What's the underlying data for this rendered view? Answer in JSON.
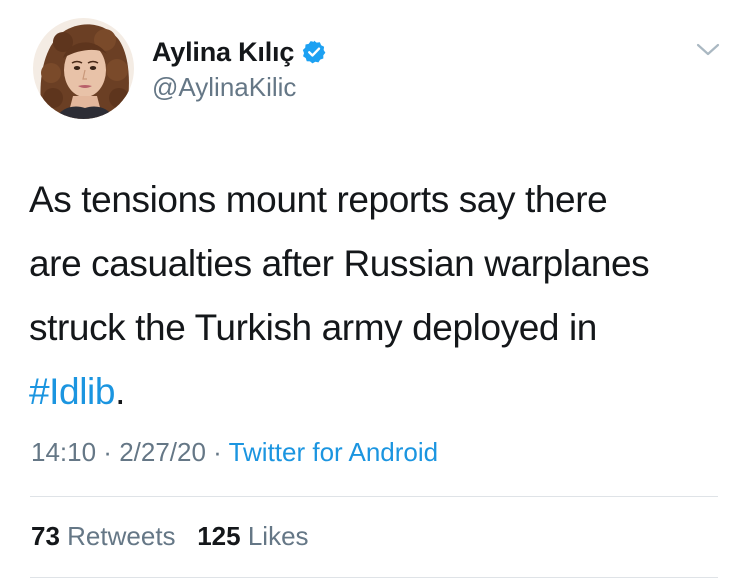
{
  "author": {
    "display_name": "Aylina Kılıç",
    "handle": "@AylinaKilic",
    "verified": true,
    "verified_icon": "verified-badge-icon",
    "avatar_icon": "profile-photo"
  },
  "tweet": {
    "text_before_hashtag": "As tensions mount reports say there\nare casualties after Russian warplanes\nstruck the Turkish army deployed in\n",
    "hashtag": "#Idlib",
    "text_after_hashtag": "."
  },
  "meta": {
    "time": "14:10",
    "separator_1": " · ",
    "date": "2/27/20",
    "separator_2": " · ",
    "source": "Twitter for Android"
  },
  "stats": {
    "retweets_count": "73",
    "retweets_label": "Retweets",
    "likes_count": "125",
    "likes_label": "Likes"
  },
  "menu": {
    "icon": "chevron-down-icon"
  },
  "colors": {
    "link": "#1b95e0",
    "secondary_text": "#657786",
    "primary_text": "#14171a",
    "divider": "#dfe3e7",
    "verified": "#1da1f2"
  }
}
